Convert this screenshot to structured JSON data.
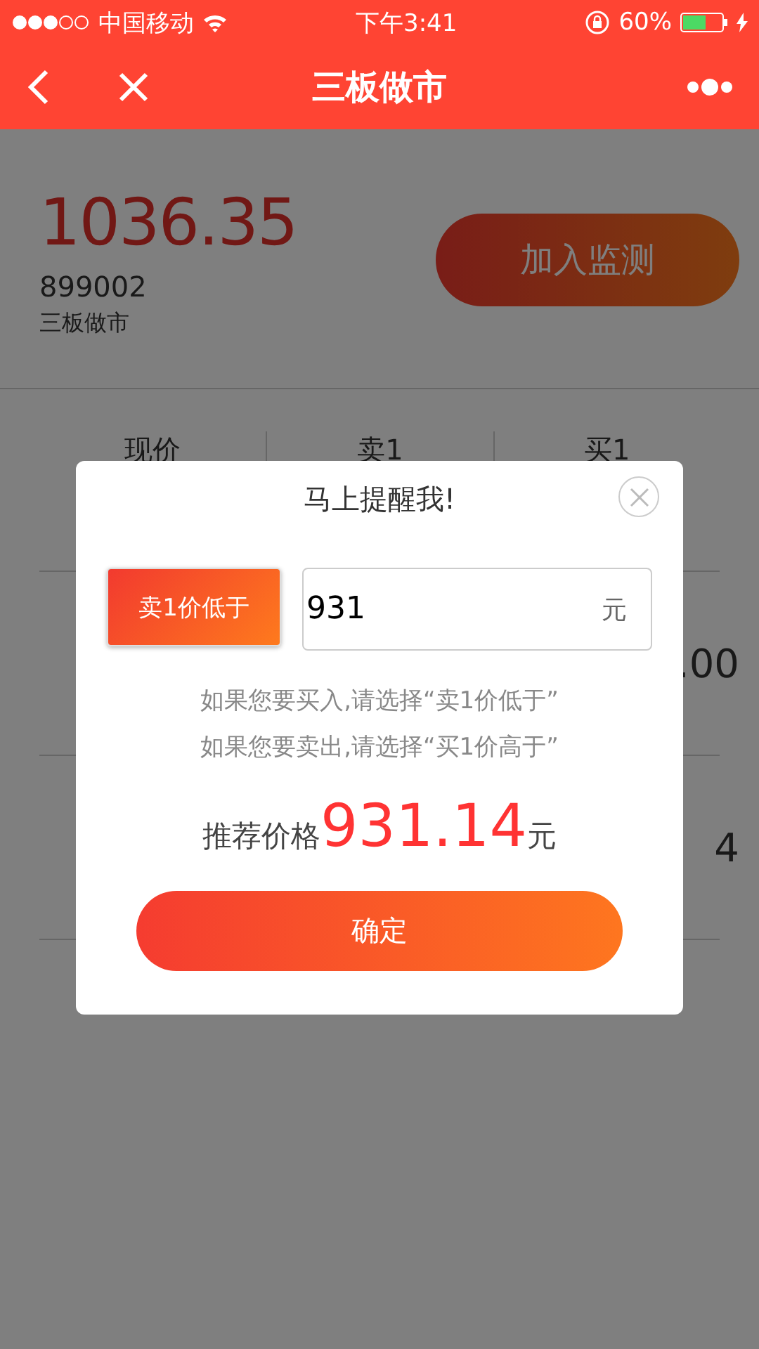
{
  "status_bar": {
    "carrier": "中国移动",
    "time": "下午3:41",
    "battery": "60%"
  },
  "nav": {
    "title": "三板做市"
  },
  "stock": {
    "price": "1036.35",
    "code": "899002",
    "market": "三板做市",
    "watch_button": "加入监测"
  },
  "table": {
    "columns": [
      "现价",
      "卖1",
      "买1"
    ],
    "rows": [
      {
        "column_3": ".00"
      },
      {
        "column_3": "4"
      }
    ]
  },
  "modal": {
    "title": "马上提醒我!",
    "selector": "卖1价低于",
    "input": {
      "value": "931",
      "unit": "元"
    },
    "hints": [
      "如果您要买入,请选择“卖1价低于”",
      "如果您要卖出,请选择“买1价高于”"
    ],
    "recommend": {
      "label": "推荐价格",
      "value": "931.14",
      "unit": "元"
    },
    "confirm": "确定"
  }
}
